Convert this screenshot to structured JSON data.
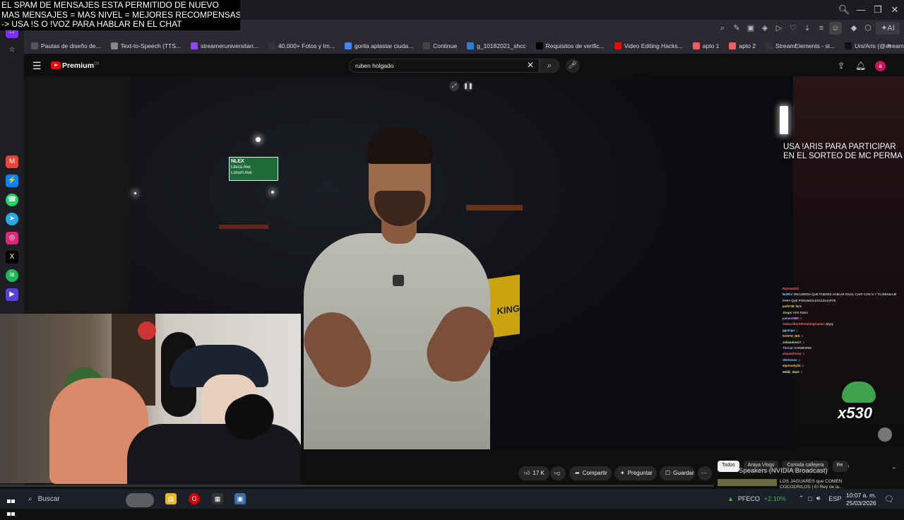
{
  "overlay_top": {
    "lines": [
      "EL SPAM DE MENSAJES ESTA PERMITIDO DE NUEVO",
      "MAS MENSAJES = MAS NIVEL = MEJORES RECOMPENSAS",
      "-> USA !S  O !VOZ PARA HABLAR EN EL CHAT"
    ]
  },
  "bookmarks": [
    {
      "label": "Pautas de diseño de...",
      "color": "#555555"
    },
    {
      "label": "Text-to-Speech (TTS...",
      "color": "#888888"
    },
    {
      "label": "streameruniversitari...",
      "color": "#9146ff"
    },
    {
      "label": "40.000+ Fotos y Im...",
      "color": "#333333"
    },
    {
      "label": "gorila aplastar ciuda...",
      "color": "#4285f4"
    },
    {
      "label": "Continue",
      "color": "#444444"
    },
    {
      "label": "g_10182021_shcc",
      "color": "#2a7fd4"
    },
    {
      "label": "Requisitos de verific...",
      "color": "#000000"
    },
    {
      "label": "Video Editing Hacks...",
      "color": "#ff0000"
    },
    {
      "label": "apto 1",
      "color": "#ff5a5f"
    },
    {
      "label": "apto 2",
      "color": "#ff5a5f"
    },
    {
      "label": "StreamElements - st...",
      "color": "#333333"
    },
    {
      "label": "Uni/Aris (@streame...",
      "color": "#111111"
    }
  ],
  "youtube": {
    "brand": "Premium",
    "brand_sup": "CO",
    "search_value": "ruben holgado",
    "avatar_letter": "a"
  },
  "overlay_sorteo": {
    "line1": "USA !ARIS PARA PARTICIPAR",
    "line2": "EN EL SORTEO DE MC PERMA"
  },
  "scene": {
    "sign_text": "NLEX",
    "sign_sub1": "Lbsca Ave",
    "sign_sub2": "Lonsm Ave",
    "yellow_text": "KING"
  },
  "chat": [
    {
      "user": "RyloVest12",
      "msg": ""
    },
    {
      "user": "BotRix",
      "msg": ": RECUERDA QUE PUEDES HABLAR EN EL CHAT CON !s Y TU MENSAJE PARA QUE PODAMOS ESCUCHARTE"
    },
    {
      "user": "pollt736",
      "msg": ": farm"
    },
    {
      "user": "Jirops",
      "msg": ": AFK Farmi"
    },
    {
      "user": "panarol485",
      "msg": ": ○"
    },
    {
      "user": "SubscriberAtRetailingGumm",
      "msg": ": wtyyy"
    },
    {
      "user": "gguinga",
      "msg": ": ○"
    },
    {
      "user": "SANTH_NIS",
      "msg": ": ○"
    },
    {
      "user": "Juliandres17",
      "msg": ": ○"
    },
    {
      "user": "TheCat",
      "msg": ": FARMFARM"
    },
    {
      "user": "alejandrosoy",
      "msg": ": ○"
    },
    {
      "user": "JheSones",
      "msg": ": ○"
    },
    {
      "user": "elprimoby02",
      "msg": ": ○"
    },
    {
      "user": "Welbi_Wutt",
      "msg": ": ○"
    }
  ],
  "sub_counter": "x530",
  "actions": {
    "likes": "17 K",
    "share": "Compartir",
    "ask": "Preguntar",
    "save": "Guardar"
  },
  "chips": [
    "Todos",
    "Araya Vlogs",
    "Comida callejera",
    "Re"
  ],
  "speakers_label": "Speakers (NVIDIA Broadcast)",
  "next_video": {
    "title_line1": "LOS JAGUARES que COMEN",
    "title_line2": "COCODRILOS | El Rey de la..."
  },
  "taskbar": {
    "search_label": "Buscar",
    "stock_name": "PFECO",
    "stock_change": "+2.10%",
    "language": "ESP",
    "time": "10:07 a. m.",
    "date": "25/03/2026"
  },
  "colors": {
    "youtube_red": "#ff0000",
    "stock_green": "#3fb950",
    "avatar": "#c2185b"
  }
}
